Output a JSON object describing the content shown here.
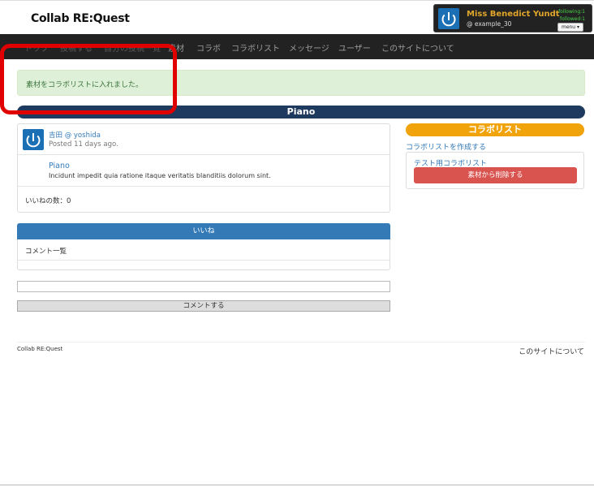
{
  "header": {
    "logo_main": "Collab",
    "logo_re": "RE:Quest",
    "user": {
      "name": "Miss Benedict Yundt",
      "handle": "@ example_30",
      "following": "following:1",
      "followed": "followed:1",
      "menu_label": "menu ▾"
    }
  },
  "nav": {
    "items": [
      "トップ",
      "投稿する",
      "自分の投稿一覧",
      "素材",
      "コラボ",
      "コラボリスト",
      "メッセージ",
      "ユーザー",
      "このサイトについて"
    ]
  },
  "alert": {
    "message": "素材をコラボリストに入れました。"
  },
  "page": {
    "title": "Piano"
  },
  "post": {
    "author": "吉田 @ yoshida",
    "posted": "Posted 11 days ago.",
    "material_title": "Piano",
    "material_desc": "Incidunt impedit quia ratione itaque veritatis blanditiis dolorum sint.",
    "likes": "いいねの数：0"
  },
  "like_section": {
    "like_button": "いいね",
    "comments_header": "コメント一覧",
    "comment_placeholder": "",
    "submit_label": "コメントする"
  },
  "sidebar": {
    "header": "コラボリスト",
    "create_link": "コラボリストを作成する",
    "list_name": "テスト用コラボリスト",
    "remove_button": "素材から削除する"
  },
  "footer": {
    "left": "Collab RE:Quest",
    "right": "このサイトについて"
  }
}
